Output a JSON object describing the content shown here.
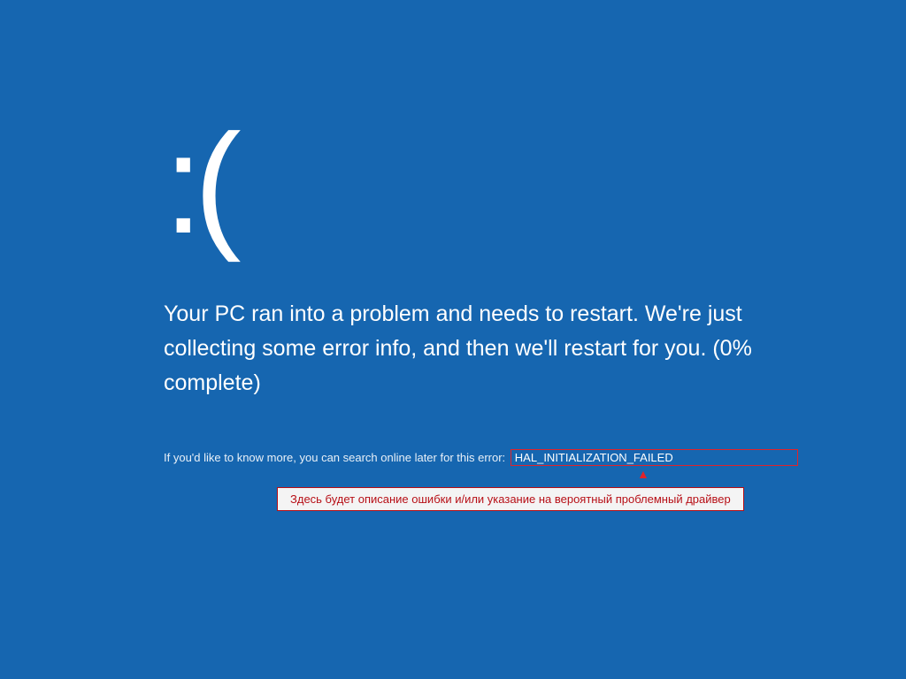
{
  "bsod": {
    "emoticon": ":(",
    "message": "Your PC ran into a problem and needs to restart. We're just collecting some error info, and then we'll restart for you. (0% complete)",
    "detail_prefix": "If you'd like to know more, you can search online later for this error:",
    "error_code": "HAL_INITIALIZATION_FAILED"
  },
  "annotation": {
    "arrow_glyph": "▲",
    "callout_text": "Здесь будет описание ошибки и/или указание на вероятный проблемный драйвер"
  },
  "colors": {
    "background": "#1666b0",
    "highlight_border": "#e2232a",
    "callout_bg": "#f4f4f4",
    "callout_text": "#b70f16"
  }
}
